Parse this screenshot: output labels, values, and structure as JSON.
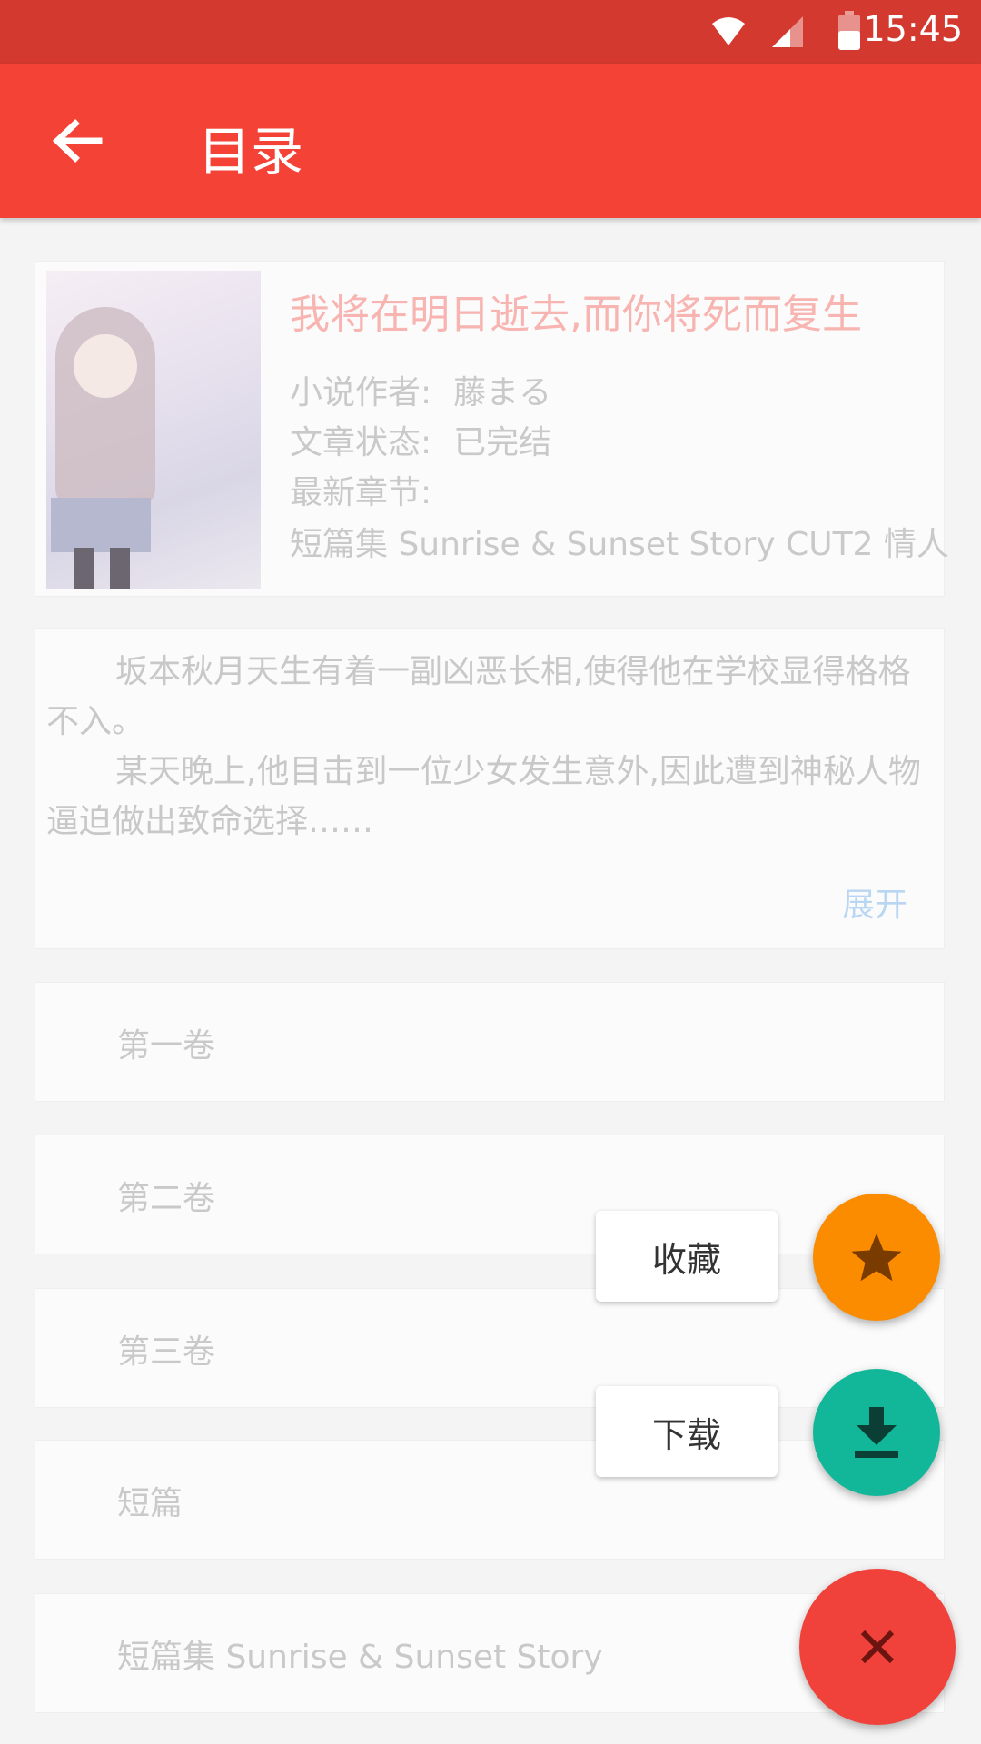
{
  "status_bar": {
    "time": "15:45"
  },
  "app_bar": {
    "title": "目录"
  },
  "book": {
    "title": "我将在明日逝去,而你将死而复生",
    "author_label": "小说作者:",
    "author": "藤まる",
    "status_label": "文章状态:",
    "status": "已完结",
    "latest_label": "最新章节:",
    "latest": "短篇集 Sunrise & Sunset Story CUT2 情人"
  },
  "description": {
    "paragraphs": [
      "坂本秋月天生有着一副凶恶长相,使得他在学校显得格格不入。",
      "某天晚上,他目击到一位少女发生意外,因此遭到神秘人物逼迫做出致命选择……"
    ],
    "expand_label": "展开"
  },
  "volumes": [
    "第一卷",
    "第二卷",
    "第三卷",
    "短篇",
    "短篇集 Sunrise & Sunset Story"
  ],
  "actions": {
    "favorite_label": "收藏",
    "download_label": "下载"
  },
  "colors": {
    "status_bar": "#d4392f",
    "app_bar": "#f44336",
    "fab_favorite": "#fb8c00",
    "fab_download": "#12b79a",
    "fab_close": "#f0413a"
  }
}
